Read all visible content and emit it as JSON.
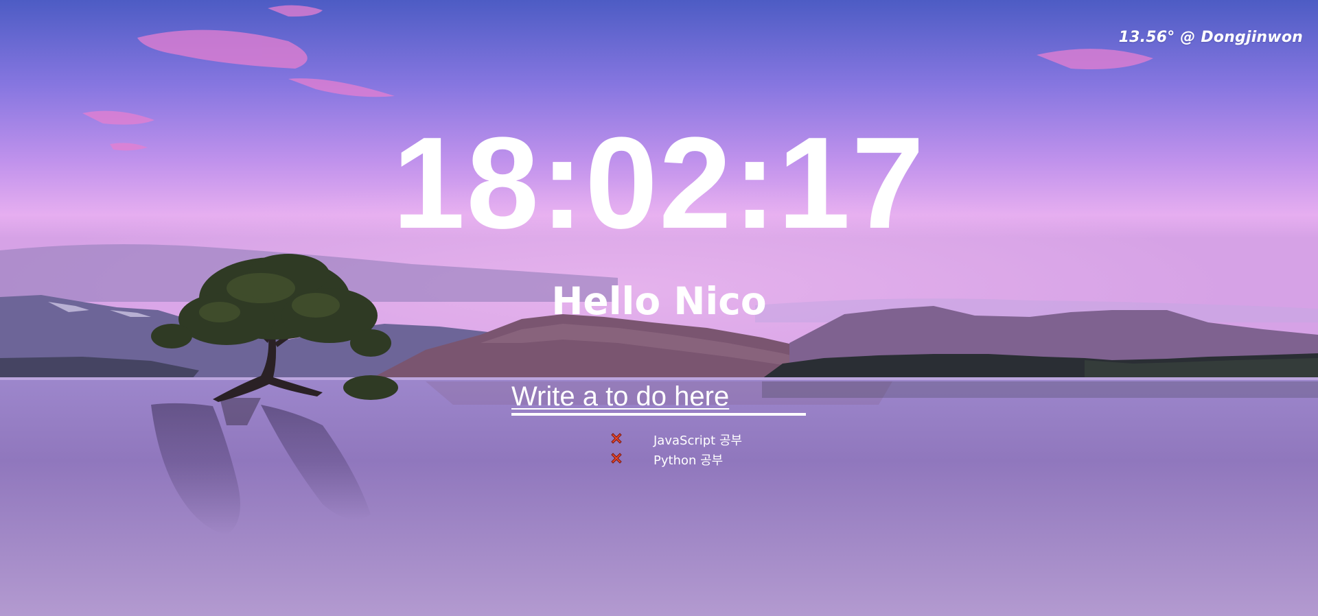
{
  "weather": {
    "text": "13.56° @ Dongjinwon"
  },
  "clock": {
    "time": "18:02:17"
  },
  "greeting": {
    "text": "Hello Nico"
  },
  "todo": {
    "placeholder": "Write a to do here",
    "items": [
      {
        "text": "JavaScript 공부",
        "delete_icon": "cross-mark-icon"
      },
      {
        "text": "Python 공부",
        "delete_icon": "cross-mark-icon"
      }
    ]
  },
  "colors": {
    "text": "#ffffff",
    "delete_icon": "#e8452c"
  },
  "background": {
    "scene": "lake-tree-mountains-purple-dusk"
  }
}
